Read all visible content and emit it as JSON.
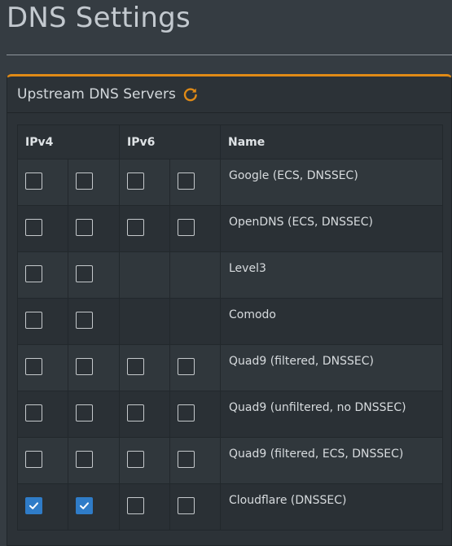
{
  "page": {
    "title": "DNS Settings"
  },
  "box": {
    "title": "Upstream DNS Servers",
    "refresh_icon": "refresh-icon"
  },
  "table": {
    "headers": {
      "ipv4": "IPv4",
      "ipv6": "IPv6",
      "name": "Name"
    },
    "rows": [
      {
        "name": "Google (ECS, DNSSEC)",
        "ipv4": [
          false,
          false
        ],
        "ipv6": [
          false,
          false
        ]
      },
      {
        "name": "OpenDNS (ECS, DNSSEC)",
        "ipv4": [
          false,
          false
        ],
        "ipv6": [
          false,
          false
        ]
      },
      {
        "name": "Level3",
        "ipv4": [
          false,
          false
        ],
        "ipv6": null
      },
      {
        "name": "Comodo",
        "ipv4": [
          false,
          false
        ],
        "ipv6": null
      },
      {
        "name": "Quad9 (filtered, DNSSEC)",
        "ipv4": [
          false,
          false
        ],
        "ipv6": [
          false,
          false
        ]
      },
      {
        "name": "Quad9 (unfiltered, no DNSSEC)",
        "ipv4": [
          false,
          false
        ],
        "ipv6": [
          false,
          false
        ]
      },
      {
        "name": "Quad9 (filtered, ECS, DNSSEC)",
        "ipv4": [
          false,
          false
        ],
        "ipv6": [
          false,
          false
        ]
      },
      {
        "name": "Cloudflare (DNSSEC)",
        "ipv4": [
          true,
          true
        ],
        "ipv6": [
          false,
          false
        ]
      }
    ]
  },
  "colors": {
    "accent": "#e08a16",
    "checked": "#2f7cc8",
    "background": "#353c42"
  }
}
